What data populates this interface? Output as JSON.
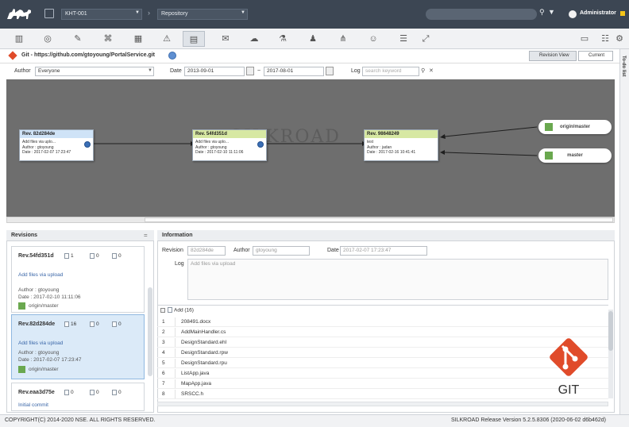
{
  "topbar": {
    "project": "KHT-001",
    "repository": "Repository",
    "user": "Administrator"
  },
  "toolbar": {
    "icons": [
      "dashboard-icon",
      "compass-icon",
      "edit-icon",
      "network-icon",
      "grid-icon",
      "warning-icon",
      "repository-icon",
      "chat-icon",
      "discussion-icon",
      "lab-icon",
      "users-icon",
      "tree-icon",
      "group-icon",
      "list-icon",
      "expand-icon",
      "panel-icon",
      "settings-list-icon",
      "gear-icon"
    ],
    "active_index": 6
  },
  "subheader": {
    "repo_url": "Git - https://github.com/gtoyoung/PortalService.git",
    "revision_view": "Revision View",
    "current": "Current",
    "todo_label": "To-do list"
  },
  "filters": {
    "author_label": "Author",
    "author_value": "Everyone",
    "date_label": "Date",
    "date_from": "2013-09-01",
    "date_sep": "~",
    "date_to": "2017-08-01",
    "log_label": "Log",
    "log_placeholder": "search keyword"
  },
  "graph": {
    "watermark": "SILKROAD",
    "nodes": [
      {
        "id": "Rev. 82d284de",
        "msg": "Add files via uplo...",
        "author": "Author : gtoyoung",
        "date": "Date : 2017-02-07 17:23:47",
        "color": "blue"
      },
      {
        "id": "Rev. 54fd351d",
        "msg": "Add files via uplo...",
        "author": "Author : gtoyoung",
        "date": "Date : 2017-02-10 11:11:06",
        "color": "green"
      },
      {
        "id": "Rev. 98648249",
        "msg": "test",
        "author": "Author : jadan",
        "date": "Date : 2017-02-16 10:41:41",
        "color": "green"
      }
    ],
    "branches": [
      "origin/master",
      "master"
    ]
  },
  "revisions": {
    "title": "Revisions",
    "items": [
      {
        "id": "Rev.54fd351d",
        "c1": "1",
        "c2": "0",
        "c3": "0",
        "msg": "Add files via upload",
        "author_label": "Author :",
        "author": "gtoyoung",
        "date_label": "Date :",
        "date": "2017-02-10 11:11:06",
        "branch": "origin/master",
        "selected": false
      },
      {
        "id": "Rev.82d284de",
        "c1": "16",
        "c2": "0",
        "c3": "0",
        "msg": "Add files via upload",
        "author_label": "Author :",
        "author": "gtoyoung",
        "date_label": "Date :",
        "date": "2017-02-07 17:23:47",
        "branch": "origin/master",
        "selected": true
      },
      {
        "id": "Rev.eaa3d75e",
        "c1": "0",
        "c2": "0",
        "c3": "0",
        "msg": "Initial commit",
        "selected": false
      }
    ]
  },
  "information": {
    "title": "Information",
    "revision_label": "Revision",
    "revision": "82d284de",
    "author_label": "Author",
    "author": "gtoyoung",
    "date_label": "Date",
    "date": "2017-02-07 17:23:47",
    "log_label": "Log",
    "log": "Add files via upload",
    "files_header": "Add (16)",
    "files": [
      "208491.docx",
      "AddMainHandler.cs",
      "DesignStandard.ehl",
      "DesignStandard.rpw",
      "DesignStandard.rpu",
      "ListApp.java",
      "MapApp.java",
      "SRSCC.h"
    ]
  },
  "git_logo_text": "GIT",
  "footer": {
    "copyright": "COPYRIGHT(C) 2014-2020 NSE. ALL RIGHTS RESERVED.",
    "release": "SILKROAD Release Version 5.2.5.8306 (2020-06-02 d6b462d)"
  },
  "colors": {
    "topbar": "#3c4653",
    "git_orange": "#e04b2a",
    "blue_header": "#cfe3f7",
    "green_header": "#d7e8a3",
    "branch_icon": "#6aa84f"
  }
}
